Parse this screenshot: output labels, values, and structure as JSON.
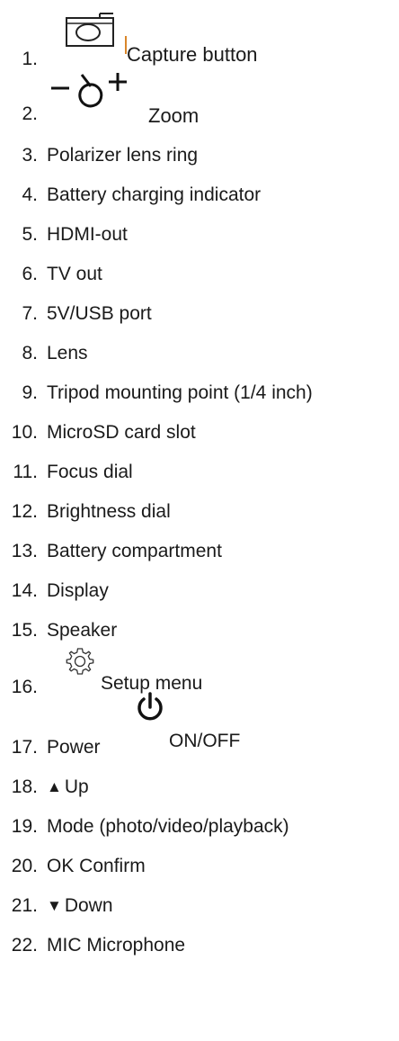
{
  "legend": {
    "items": [
      {
        "number": "1.",
        "label": "Capture button",
        "icon": "camera-icon",
        "accent_color": "#d9862a"
      },
      {
        "number": "2.",
        "label": "Zoom",
        "icon": "zoom-minus-plus-icon"
      },
      {
        "number": "3.",
        "label": "Polarizer lens ring"
      },
      {
        "number": "4.",
        "label": "Battery charging indicator"
      },
      {
        "number": "5.",
        "label": "HDMI-out"
      },
      {
        "number": "6.",
        "label": "TV out"
      },
      {
        "number": "7.",
        "label": "5V/USB port"
      },
      {
        "number": "8.",
        "label": "Lens"
      },
      {
        "number": "9.",
        "label": "Tripod mounting point (1/4 inch)"
      },
      {
        "number": "10.",
        "label": "MicroSD card slot"
      },
      {
        "number": "11.",
        "label": "Focus dial"
      },
      {
        "number": "12.",
        "label": "Brightness dial"
      },
      {
        "number": "13.",
        "label": "Battery compartment"
      },
      {
        "number": "14.",
        "label": "Display"
      },
      {
        "number": "15.",
        "label": "Speaker"
      },
      {
        "number": "16.",
        "label": "Setup menu",
        "icon": "gear-icon"
      },
      {
        "number": "17.",
        "label_before": "Power",
        "label_after": "ON/OFF",
        "icon": "power-icon"
      },
      {
        "number": "18.",
        "label": "Up",
        "icon": "up-triangle-icon",
        "glyph": "▲"
      },
      {
        "number": "19.",
        "label": "Mode (photo/video/playback)"
      },
      {
        "number": "20.",
        "label": "OK Confirm"
      },
      {
        "number": "21.",
        "label": "Down",
        "icon": "down-triangle-icon",
        "glyph": "▼"
      },
      {
        "number": "22.",
        "label": "MIC Microphone"
      }
    ]
  }
}
